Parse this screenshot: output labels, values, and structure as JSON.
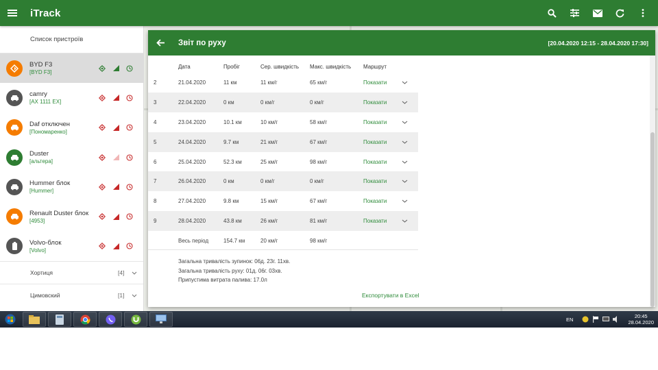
{
  "app": {
    "title": "iTrack"
  },
  "colors": {
    "primary": "#2e7d32",
    "link": "#2e8b3a",
    "orange": "#f57c00",
    "dark": "#555555",
    "green_avatar": "#2e7d32"
  },
  "topbar": {
    "icons": [
      "menu-icon",
      "search-icon",
      "filter-icon",
      "mail-icon",
      "refresh-icon",
      "more-vert-icon"
    ]
  },
  "sidebar": {
    "header": "Список пристроїв",
    "devices": [
      {
        "name": "BYD F3",
        "sub": "[BYD F3]",
        "avatar": "orange",
        "icon": "navigation-icon",
        "selected": true
      },
      {
        "name": "camry",
        "sub": "[AX 1111 EX]",
        "avatar": "dark",
        "icon": "car-icon",
        "selected": false
      },
      {
        "name": "Daf отключен",
        "sub": "[Пономаренко]",
        "avatar": "orange",
        "icon": "car-icon",
        "selected": false
      },
      {
        "name": "Duster",
        "sub": "[альтера]",
        "avatar": "green",
        "icon": "car-icon",
        "selected": false
      },
      {
        "name": "Hummer блок",
        "sub": "[Hummer]",
        "avatar": "dark",
        "icon": "car-icon",
        "selected": false
      },
      {
        "name": "Renault Duster блок",
        "sub": "[4953]",
        "avatar": "orange",
        "icon": "car-icon",
        "selected": false
      },
      {
        "name": "Volvo-блок",
        "sub": "[Volvo]",
        "avatar": "dark",
        "icon": "battery-icon",
        "selected": false
      }
    ],
    "groups": [
      {
        "name": "Хортиця",
        "count": "[4]"
      },
      {
        "name": "Цимовский",
        "count": "[1]"
      }
    ]
  },
  "report": {
    "title": "Звіт по руху",
    "period": "[20.04.2020  12:15  -  28.04.2020  17:30]",
    "columns": {
      "date": "Дата",
      "distance": "Пробіг",
      "avg_speed": "Сер. швидкість",
      "max_speed": "Макс. швидкість",
      "route": "Маршрут"
    },
    "rows": [
      {
        "num": "2",
        "date": "21.04.2020",
        "distance": "11 км",
        "avg": "11 км/г",
        "max": "65 км/г",
        "route": "Показати"
      },
      {
        "num": "3",
        "date": "22.04.2020",
        "distance": "0 км",
        "avg": "0 км/г",
        "max": "0 км/г",
        "route": "Показати"
      },
      {
        "num": "4",
        "date": "23.04.2020",
        "distance": "10.1 км",
        "avg": "10 км/г",
        "max": "58 км/г",
        "route": "Показати"
      },
      {
        "num": "5",
        "date": "24.04.2020",
        "distance": "9.7 км",
        "avg": "21 км/г",
        "max": "67 км/г",
        "route": "Показати"
      },
      {
        "num": "6",
        "date": "25.04.2020",
        "distance": "52.3 км",
        "avg": "25 км/г",
        "max": "98 км/г",
        "route": "Показати"
      },
      {
        "num": "7",
        "date": "26.04.2020",
        "distance": "0 км",
        "avg": "0 км/г",
        "max": "0 км/г",
        "route": "Показати"
      },
      {
        "num": "8",
        "date": "27.04.2020",
        "distance": "9.8 км",
        "avg": "15 км/г",
        "max": "67 км/г",
        "route": "Показати"
      },
      {
        "num": "9",
        "date": "28.04.2020",
        "distance": "43.8 км",
        "avg": "26 км/г",
        "max": "81 км/г",
        "route": "Показати"
      }
    ],
    "total": {
      "label": "Весь період",
      "distance": "154.7 км",
      "avg": "20 км/г",
      "max": "98 км/г"
    },
    "summary": {
      "stops": "Загальна тривалість зупинок:   06д. 23г. 11хв.",
      "moving": "Загальна тривалість руху:   01д. 06г. 03хв.",
      "fuel": "Припустима витрата палива:   17.0л"
    },
    "export_label": "Експортувати в Excel"
  },
  "taskbar": {
    "apps": [
      "file-explorer-icon",
      "calculator-icon",
      "chrome-icon",
      "viber-icon",
      "utorrent-icon",
      "remote-desktop-icon"
    ],
    "lang": "EN",
    "time": "20:45",
    "date": "28.04.2020"
  }
}
